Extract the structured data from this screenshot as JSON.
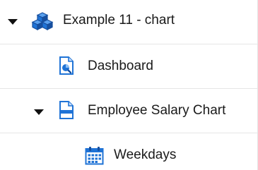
{
  "tree": {
    "items": [
      {
        "label": "Example 11 - chart",
        "icon": "package-cubes-icon",
        "expanded": true
      },
      {
        "label": "Dashboard",
        "icon": "dashboard-report-icon"
      },
      {
        "label": "Employee Salary Chart",
        "icon": "chart-document-icon",
        "expanded": true
      },
      {
        "label": "Weekdays",
        "icon": "calendar-icon"
      }
    ]
  },
  "colors": {
    "icon_blue": "#1f73d6",
    "icon_dark_blue": "#174f9e",
    "text": "#1a1a1a",
    "divider": "#e6e6e6"
  }
}
